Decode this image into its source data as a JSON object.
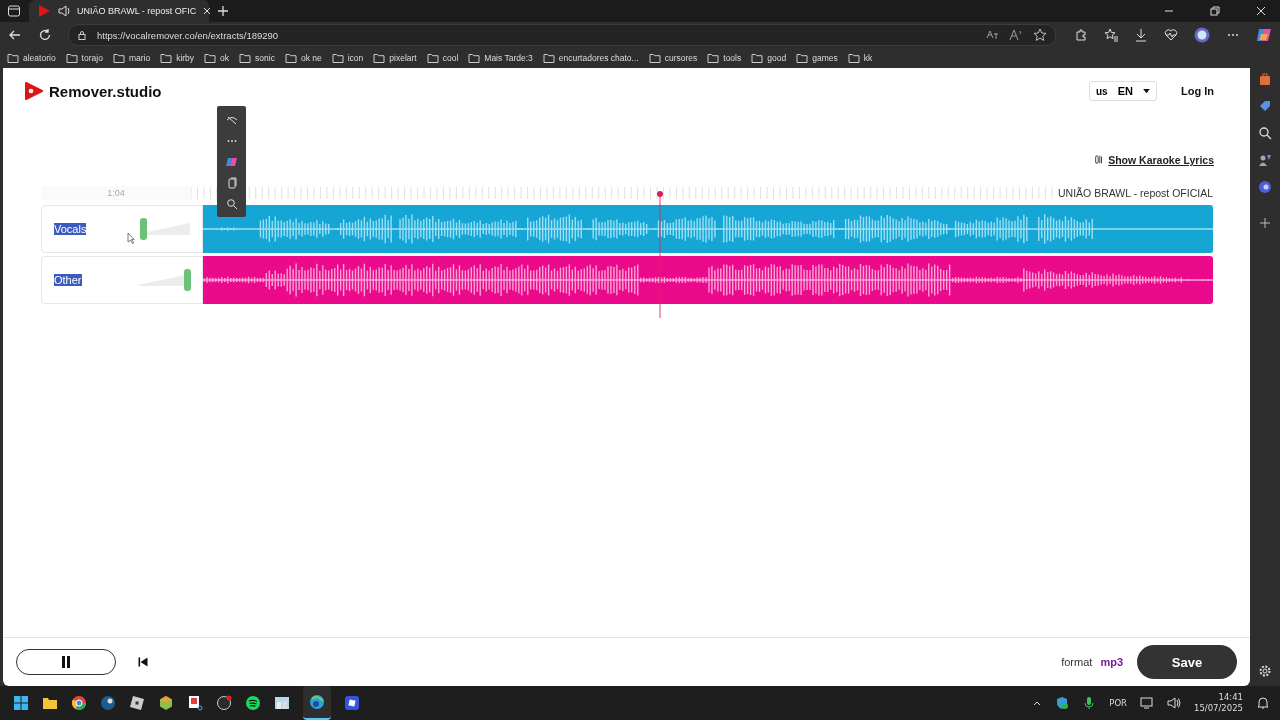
{
  "browser": {
    "tab": {
      "title": "UNIÃO BRAWL - repost OFIC"
    },
    "address": "https://vocalremover.co/en/extracts/189290",
    "bookmarks": [
      "aleatorio",
      "torajo",
      "mario",
      "kirby",
      "ok",
      "sonic",
      "ok ne",
      "icon",
      "pixelart",
      "cool",
      "Mais Tarde:3",
      "encurtadores chato...",
      "cursores",
      "tools",
      "good",
      "games",
      "kk"
    ]
  },
  "page": {
    "logo": "Remover.studio",
    "language": {
      "flag": "us",
      "code": "EN"
    },
    "login": "Log In",
    "karaoke_link": "Show Karaoke Lyrics",
    "timeline": {
      "time": "1:04",
      "title": "UNIÃO BRAWL - repost OFICIAL"
    },
    "tracks": [
      {
        "name": "Vocals",
        "kind": "vocals",
        "text_selected": true,
        "level": 0.05,
        "color": "#16a6d6"
      },
      {
        "name": "Other",
        "kind": "other",
        "text_selected": true,
        "level": 1,
        "color": "#ec0a8c"
      }
    ],
    "footer": {
      "format_label": "format",
      "format_value": "mp3",
      "save": "Save"
    }
  },
  "taskbar": {
    "language": "POR",
    "time": "14:41",
    "date": "15/07/2025"
  }
}
